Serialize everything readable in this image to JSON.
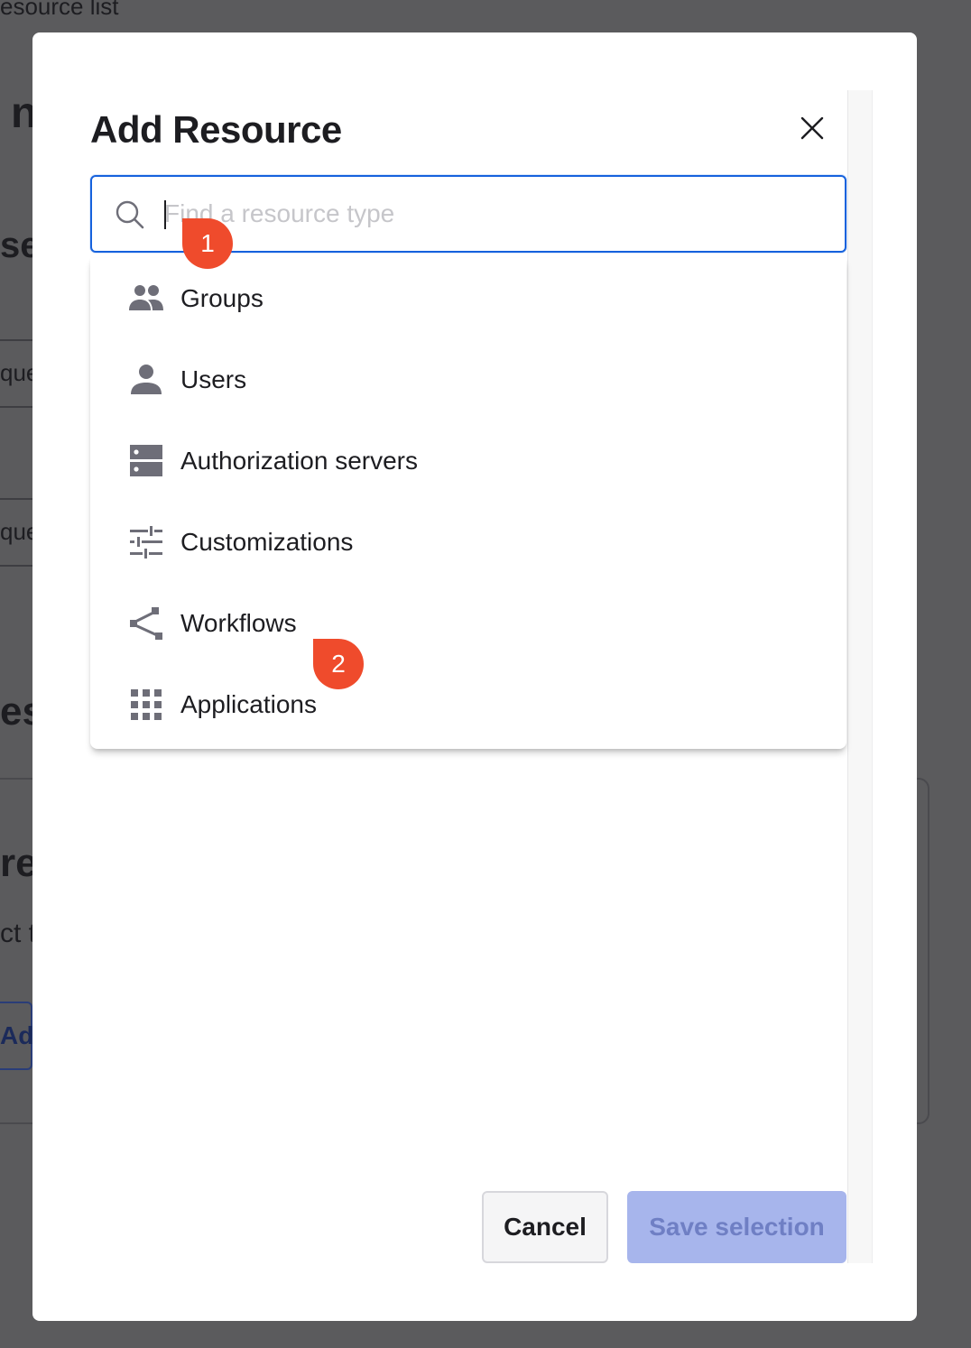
{
  "background": {
    "fragments": [
      "esource list",
      "n",
      "se",
      "que",
      "que",
      "es",
      "re",
      "ct t",
      "Add"
    ]
  },
  "modal": {
    "title": "Add Resource",
    "close_icon": "close-icon",
    "search": {
      "placeholder": "Find a resource type",
      "value": "",
      "icon": "search-icon"
    },
    "options": [
      {
        "label": "Groups",
        "icon": "groups-icon"
      },
      {
        "label": "Users",
        "icon": "user-icon"
      },
      {
        "label": "Authorization servers",
        "icon": "server-icon"
      },
      {
        "label": "Customizations",
        "icon": "sliders-icon"
      },
      {
        "label": "Workflows",
        "icon": "workflow-icon"
      },
      {
        "label": "Applications",
        "icon": "apps-grid-icon"
      }
    ],
    "footer": {
      "cancel_label": "Cancel",
      "save_label": "Save selection"
    }
  },
  "annotations": {
    "marker_1": "1",
    "marker_2": "2"
  },
  "colors": {
    "focus_blue": "#1662dd",
    "marker_red": "#ef4b2c",
    "save_disabled_bg": "#a7b5ec",
    "icon_gray": "#6e6e78"
  }
}
